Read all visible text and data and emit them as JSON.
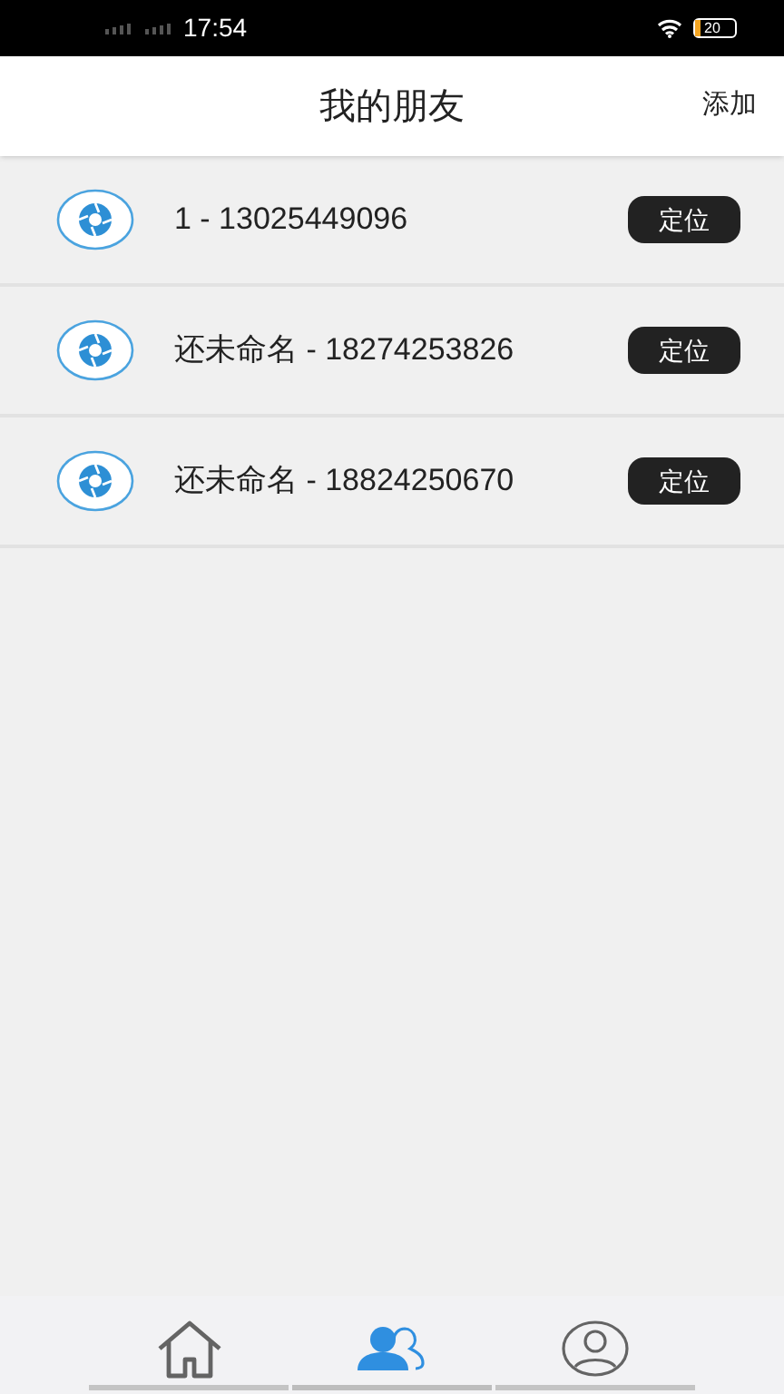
{
  "status_bar": {
    "time": "17:54",
    "battery": "20"
  },
  "header": {
    "title": "我的朋友",
    "action": "添加"
  },
  "friends": [
    {
      "label": "1 - 13025449096",
      "button": "定位"
    },
    {
      "label": "还未命名 - 18274253826",
      "button": "定位"
    },
    {
      "label": "还未命名 - 18824250670",
      "button": "定位"
    }
  ],
  "tabs": [
    {
      "kind": "home",
      "selected": false
    },
    {
      "kind": "friends",
      "selected": true
    },
    {
      "kind": "profile",
      "selected": false
    }
  ]
}
